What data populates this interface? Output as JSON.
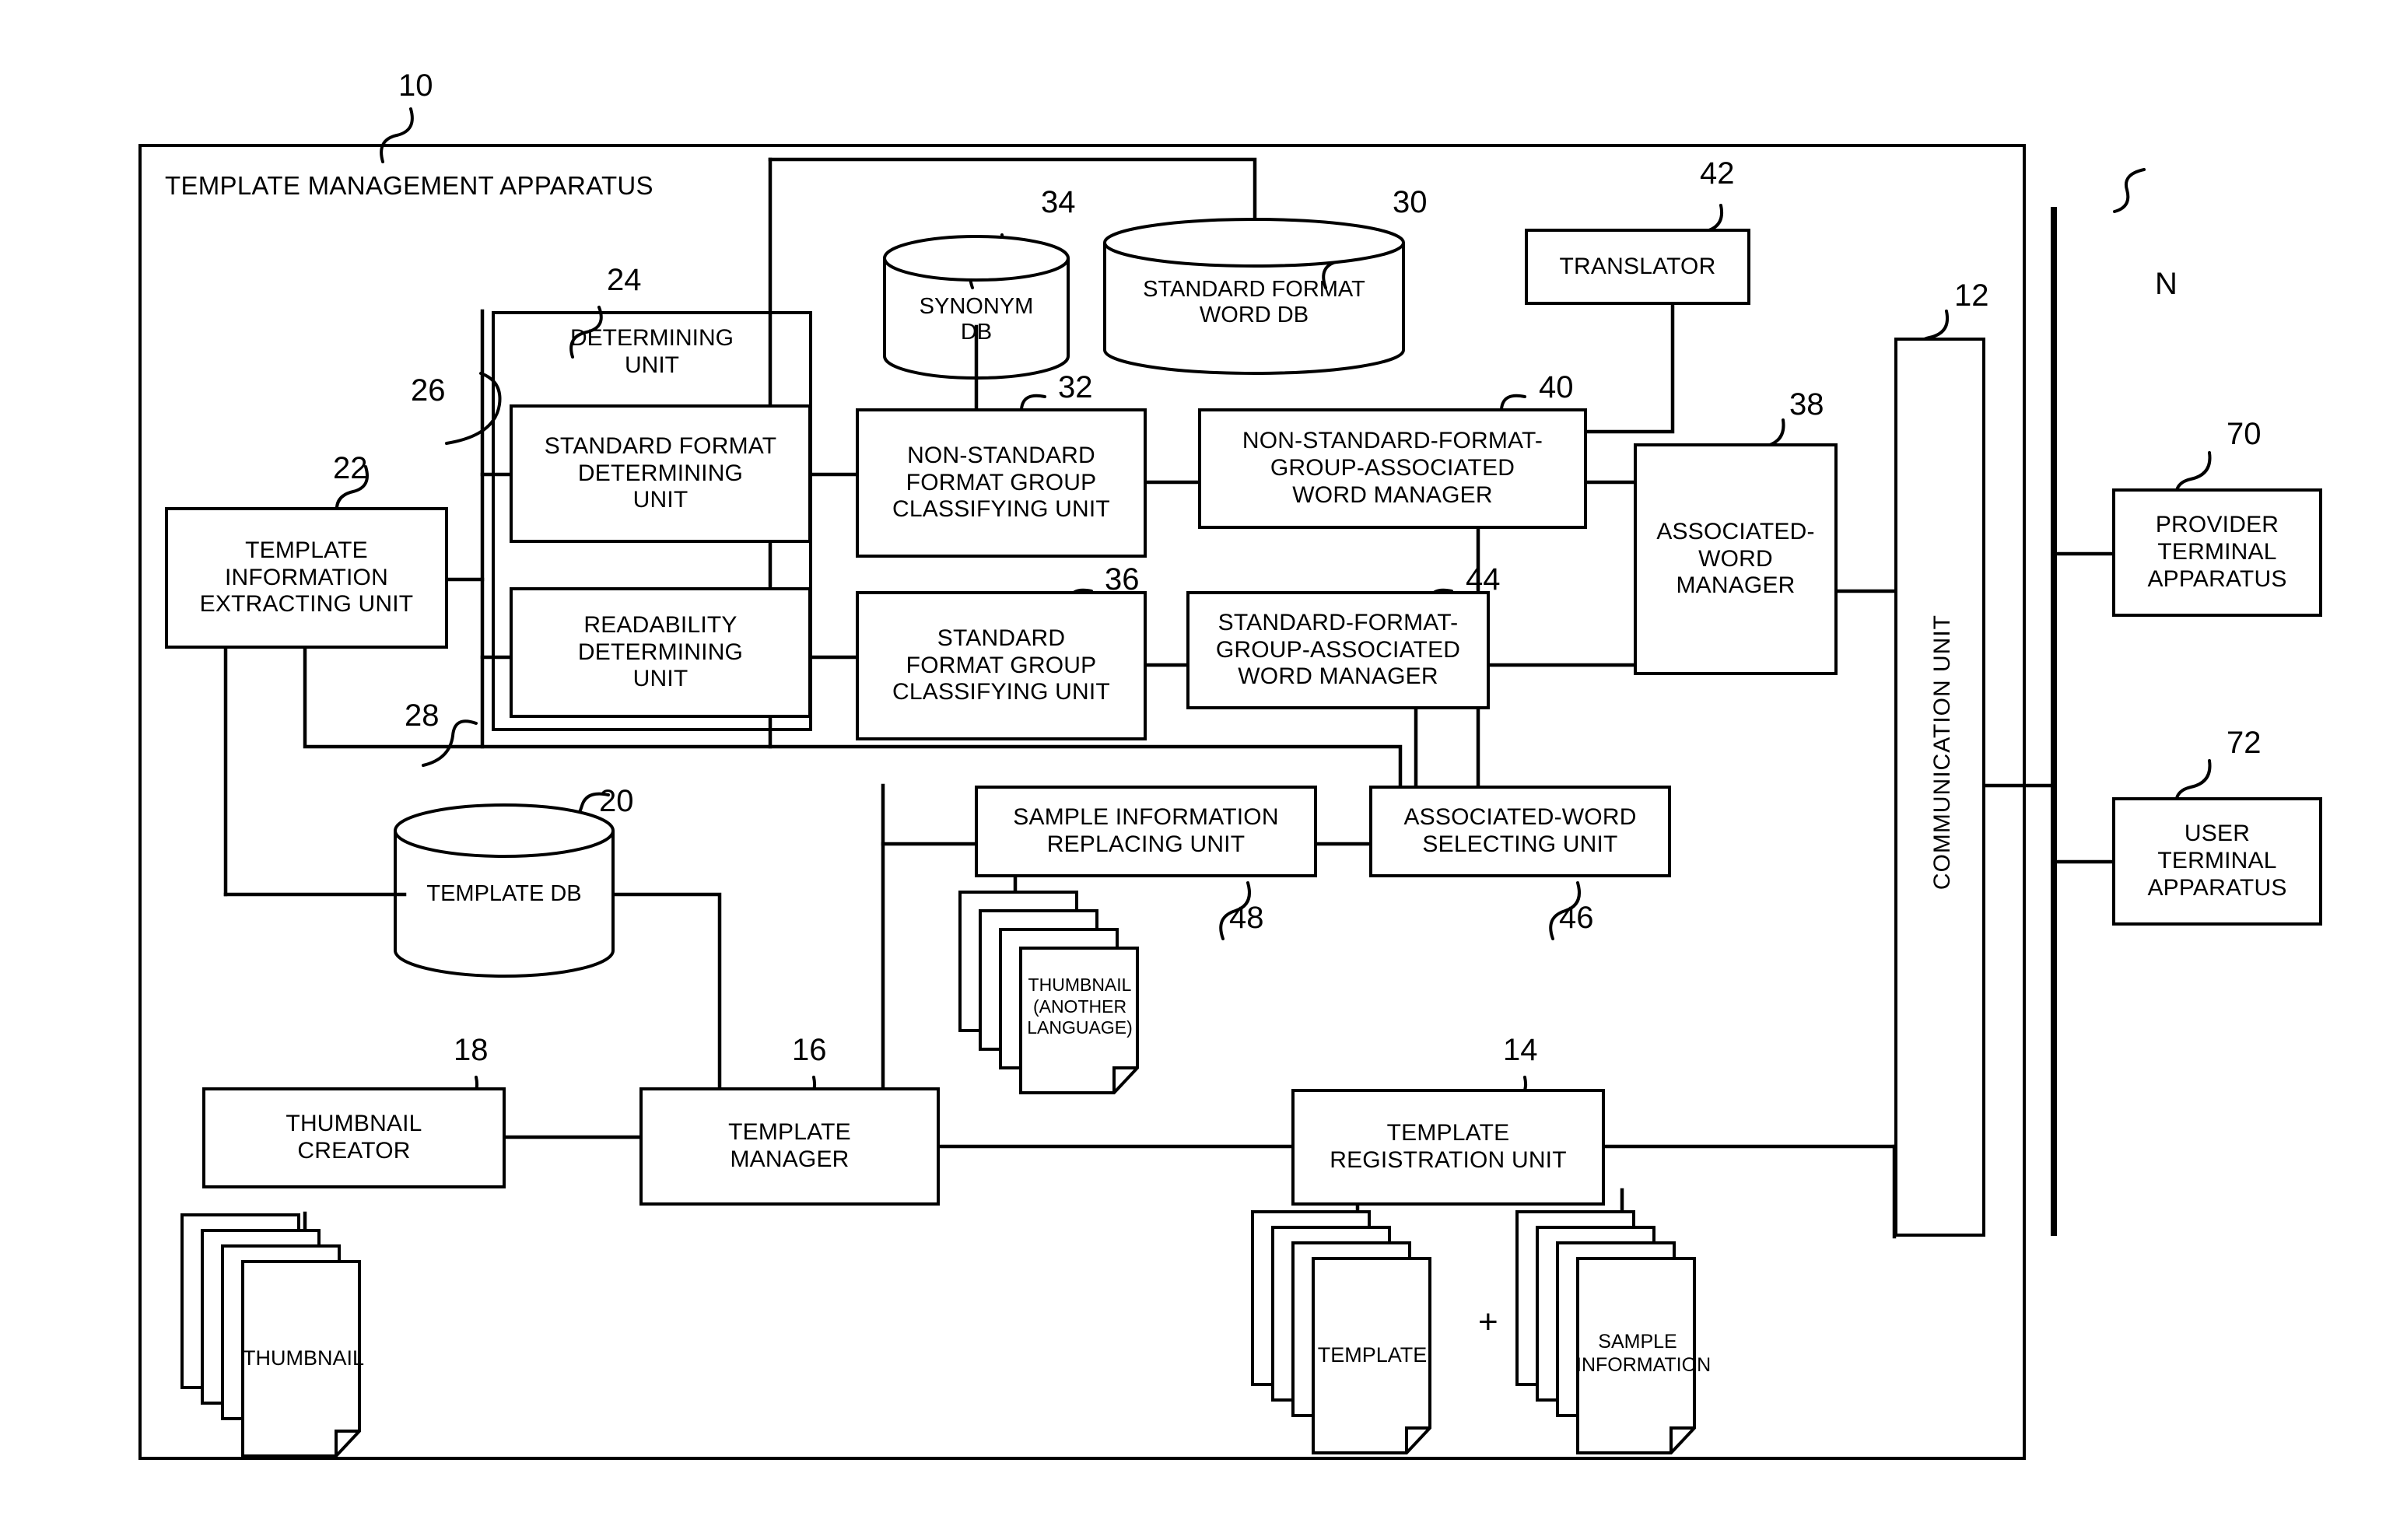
{
  "figure": {
    "title": "TEMPLATE MANAGEMENT APPARATUS",
    "apparatus_ref": "10",
    "network_label": "N"
  },
  "refs": {
    "apparatus": "10",
    "communication_unit": "12",
    "template_registration_unit": "14",
    "template_manager": "16",
    "thumbnail_creator": "18",
    "template_db": "20",
    "template_information_extracting_unit": "22",
    "determining_unit": "24",
    "standard_format_determining_unit": "26",
    "readability_determining_unit": "28",
    "standard_format_word_db": "30",
    "non_standard_format_group_classifying_unit": "32",
    "synonym_db": "34",
    "standard_format_group_classifying_unit": "36",
    "associated_word_manager": "38",
    "non_standard_format_group_associated_word_manager": "40",
    "translator": "42",
    "standard_format_group_associated_word_manager": "44",
    "associated_word_selecting_unit": "46",
    "sample_information_replacing_unit": "48",
    "provider_terminal_apparatus": "70",
    "user_terminal_apparatus": "72"
  },
  "blocks": {
    "template_information_extracting_unit": "TEMPLATE\nINFORMATION\nEXTRACTING UNIT",
    "determining_unit": "DETERMINING\nUNIT",
    "standard_format_determining_unit": "STANDARD FORMAT\nDETERMINING\nUNIT",
    "readability_determining_unit": "READABILITY\nDETERMINING\nUNIT",
    "non_standard_format_group_classifying_unit": "NON-STANDARD\nFORMAT GROUP\nCLASSIFYING UNIT",
    "standard_format_group_classifying_unit": "STANDARD\nFORMAT GROUP\nCLASSIFYING UNIT",
    "non_standard_format_group_associated_word_manager": "NON-STANDARD-FORMAT-\nGROUP-ASSOCIATED\nWORD MANAGER",
    "standard_format_group_associated_word_manager": "STANDARD-FORMAT-\nGROUP-ASSOCIATED\nWORD MANAGER",
    "associated_word_manager": "ASSOCIATED-\nWORD\nMANAGER",
    "translator": "TRANSLATOR",
    "communication_unit": "COMMUNICATION UNIT",
    "sample_information_replacing_unit": "SAMPLE INFORMATION\nREPLACING UNIT",
    "associated_word_selecting_unit": "ASSOCIATED-WORD\nSELECTING UNIT",
    "thumbnail_creator": "THUMBNAIL\nCREATOR",
    "template_manager": "TEMPLATE\nMANAGER",
    "template_registration_unit": "TEMPLATE\nREGISTRATION UNIT",
    "provider_terminal_apparatus": "PROVIDER\nTERMINAL\nAPPARATUS",
    "user_terminal_apparatus": "USER\nTERMINAL\nAPPARATUS"
  },
  "databases": {
    "synonym_db": "SYNONYM\nDB",
    "standard_format_word_db": "STANDARD FORMAT\nWORD DB",
    "template_db": "TEMPLATE DB"
  },
  "documents": {
    "thumbnail_another_language": "THUMBNAIL\n(ANOTHER\nLANGUAGE)",
    "thumbnail": "THUMBNAIL",
    "template": "TEMPLATE",
    "sample_information": "SAMPLE\nINFORMATION",
    "plus": "+"
  }
}
